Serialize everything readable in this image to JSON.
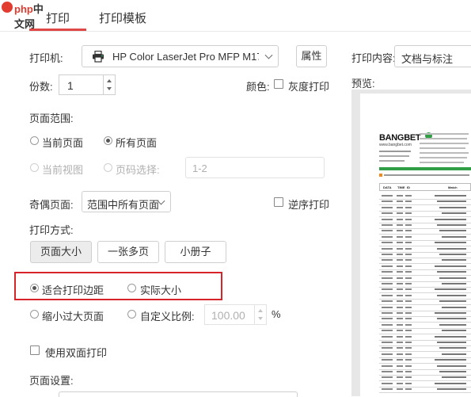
{
  "logo": {
    "text_latin": "php",
    "text_cn": "中文网"
  },
  "tabs": [
    {
      "label": "打印"
    },
    {
      "label": "打印模板"
    }
  ],
  "printer": {
    "label": "打印机:",
    "value": "HP Color LaserJet Pro MFP M17",
    "properties_button": "属性"
  },
  "print_content": {
    "label": "打印内容:",
    "value": "文档与标注"
  },
  "copies": {
    "label": "份数:",
    "value": "1"
  },
  "color": {
    "label": "颜色:",
    "grayscale_label": "灰度打印",
    "grayscale_checked": false
  },
  "preview_label": "预览:",
  "page_range": {
    "title": "页面范围:",
    "options": [
      {
        "label": "当前页面",
        "checked": false,
        "disabled": false
      },
      {
        "label": "所有页面",
        "checked": true,
        "disabled": false
      },
      {
        "label": "当前视图",
        "checked": false,
        "disabled": true
      },
      {
        "label": "页码选择:",
        "checked": false,
        "disabled": true
      }
    ],
    "page_selection_placeholder": "1-2"
  },
  "odd_even": {
    "label": "奇偶页面:",
    "value": "范围中所有页面",
    "reverse_label": "逆序打印",
    "reverse_checked": false
  },
  "print_mode": {
    "title": "打印方式:",
    "buttons": [
      {
        "label": "页面大小",
        "pressed": true
      },
      {
        "label": "一张多页",
        "pressed": false
      },
      {
        "label": "小册子",
        "pressed": false
      }
    ],
    "fit_options": [
      {
        "label": "适合打印边距",
        "checked": true
      },
      {
        "label": "实际大小",
        "checked": false
      },
      {
        "label": "缩小过大页面",
        "checked": false
      },
      {
        "label": "自定义比例:",
        "checked": false
      }
    ],
    "scale_value": "100.00",
    "scale_unit": "%"
  },
  "duplex": {
    "label": "使用双面打印",
    "checked": false
  },
  "page_setup": {
    "title": "页面设置:"
  },
  "preview": {
    "brand": "BANGBET",
    "site": "www.bangbet.com",
    "table_header": [
      "DATA",
      "TIME",
      "ID",
      "Match"
    ]
  },
  "colors": {
    "accent": "#e04848",
    "highlight": "#d8232a",
    "preview_green": "#2f9e44",
    "preview_orange": "#f08a1c"
  }
}
